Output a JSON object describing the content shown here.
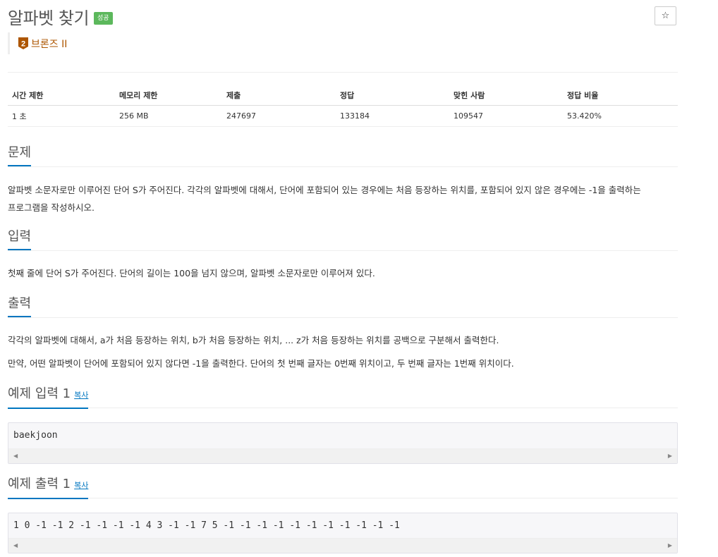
{
  "problem": {
    "title": "알파벳 찾기",
    "status_badge": "성공",
    "star_icon": "☆",
    "tier": {
      "label": "브론즈 II",
      "level": "2"
    }
  },
  "info_table": {
    "headers": [
      "시간 제한",
      "메모리 제한",
      "제출",
      "정답",
      "맞힌 사람",
      "정답 비율"
    ],
    "values": [
      "1 초",
      "256 MB",
      "247697",
      "133184",
      "109547",
      "53.420%"
    ]
  },
  "sections": {
    "problem": {
      "title": "문제",
      "lines": [
        "알파벳 소문자로만 이루어진 단어 S가 주어진다. 각각의 알파벳에 대해서, 단어에 포함되어 있는 경우에는 처음 등장하는 위치를, 포함되어 있지 않은 경우에는 -1을 출력하는",
        "프로그램을 작성하시오."
      ]
    },
    "input": {
      "title": "입력",
      "text": "첫째 줄에 단어 S가 주어진다. 단어의 길이는 100을 넘지 않으며, 알파벳 소문자로만 이루어져 있다."
    },
    "output": {
      "title": "출력",
      "text1": "각각의 알파벳에 대해서, a가 처음 등장하는 위치, b가 처음 등장하는 위치, ... z가 처음 등장하는 위치를 공백으로 구분해서 출력한다.",
      "text2": "만약, 어떤 알파벳이 단어에 포함되어 있지 않다면 -1을 출력한다. 단어의 첫 번째 글자는 0번째 위치이고, 두 번째 글자는 1번째 위치이다."
    },
    "sample_input": {
      "title": "예제 입력 1",
      "copy_label": "복사",
      "content": "baekjoon"
    },
    "sample_output": {
      "title": "예제 출력 1",
      "copy_label": "복사",
      "content": "1 0 -1 -1 2 -1 -1 -1 -1 4 3 -1 -1 7 5 -1 -1 -1 -1 -1 -1 -1 -1 -1 -1 -1"
    }
  },
  "colors": {
    "success": "#5cb85c",
    "bronze": "#ad5600",
    "link": "#0076c0"
  }
}
